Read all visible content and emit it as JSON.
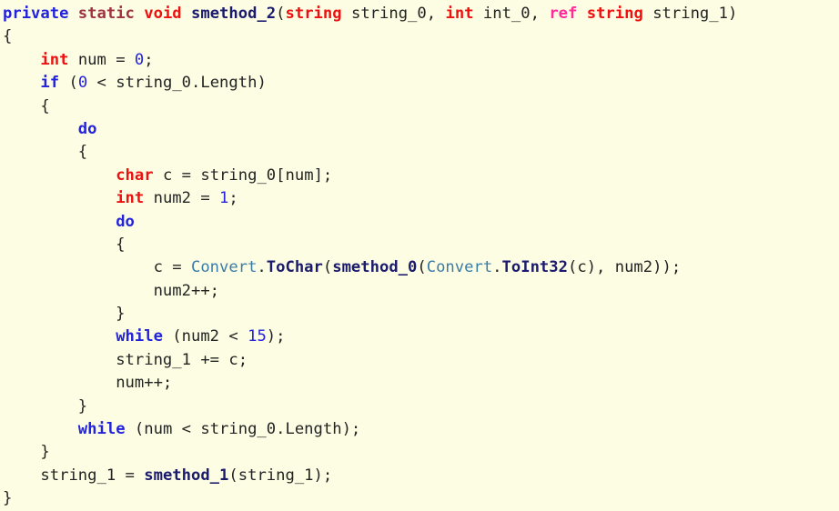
{
  "editor": {
    "name": "decompiled-code-view",
    "language": "csharp",
    "background_color": "#fdfde3",
    "default_text_color": "#232323",
    "line_count": 22,
    "colors": {
      "control_keyword": "#2323dc",
      "modifier_keyword": "#a03242",
      "type_keyword": "#ee1111",
      "ref_keyword": "#ff2b99",
      "number_literal": "#2323dc",
      "method_name": "#1b1b6e",
      "class_name": "#3a7ca8",
      "identifier": "#232323"
    }
  },
  "code": {
    "plain_text": "private static void smethod_2(string string_0, int int_0, ref string string_1)\n{\n    int num = 0;\n    if (0 < string_0.Length)\n    {\n        do\n        {\n            char c = string_0[num];\n            int num2 = 1;\n            do\n            {\n                c = Convert.ToChar(smethod_0(Convert.ToInt32(c), num2));\n                num2++;\n            }\n            while (num2 < 15);\n            string_1 += c;\n            num++;\n        }\n        while (num < string_0.Length);\n    }\n    string_1 = smethod_1(string_1);\n}",
    "lines": [
      {
        "indent": 0,
        "tokens": [
          {
            "t": "private",
            "c": "k-ctrl"
          },
          {
            "t": " ",
            "c": "punct"
          },
          {
            "t": "static",
            "c": "k-mod"
          },
          {
            "t": " ",
            "c": "punct"
          },
          {
            "t": "void",
            "c": "k-type"
          },
          {
            "t": " ",
            "c": "punct"
          },
          {
            "t": "smethod_2",
            "c": "method"
          },
          {
            "t": "(",
            "c": "punct"
          },
          {
            "t": "string",
            "c": "k-type"
          },
          {
            "t": " ",
            "c": "punct"
          },
          {
            "t": "string_0",
            "c": "id"
          },
          {
            "t": ", ",
            "c": "punct"
          },
          {
            "t": "int",
            "c": "k-type"
          },
          {
            "t": " ",
            "c": "punct"
          },
          {
            "t": "int_0",
            "c": "id"
          },
          {
            "t": ", ",
            "c": "punct"
          },
          {
            "t": "ref",
            "c": "k-ref"
          },
          {
            "t": " ",
            "c": "punct"
          },
          {
            "t": "string",
            "c": "k-type"
          },
          {
            "t": " ",
            "c": "punct"
          },
          {
            "t": "string_1",
            "c": "id"
          },
          {
            "t": ")",
            "c": "punct"
          }
        ]
      },
      {
        "indent": 0,
        "tokens": [
          {
            "t": "{",
            "c": "punct"
          }
        ]
      },
      {
        "indent": 0,
        "tokens": [
          {
            "t": "    ",
            "c": "punct"
          },
          {
            "t": "int",
            "c": "k-type"
          },
          {
            "t": " ",
            "c": "punct"
          },
          {
            "t": "num",
            "c": "id"
          },
          {
            "t": " = ",
            "c": "punct"
          },
          {
            "t": "0",
            "c": "num"
          },
          {
            "t": ";",
            "c": "punct"
          }
        ]
      },
      {
        "indent": 0,
        "tokens": [
          {
            "t": "    ",
            "c": "punct"
          },
          {
            "t": "if",
            "c": "k-ctrl"
          },
          {
            "t": " (",
            "c": "punct"
          },
          {
            "t": "0",
            "c": "num"
          },
          {
            "t": " < ",
            "c": "punct"
          },
          {
            "t": "string_0.Length",
            "c": "id"
          },
          {
            "t": ")",
            "c": "punct"
          }
        ]
      },
      {
        "indent": 0,
        "tokens": [
          {
            "t": "    {",
            "c": "punct"
          }
        ]
      },
      {
        "indent": 0,
        "tokens": [
          {
            "t": "        ",
            "c": "punct"
          },
          {
            "t": "do",
            "c": "k-ctrl"
          }
        ]
      },
      {
        "indent": 0,
        "tokens": [
          {
            "t": "        {",
            "c": "punct"
          }
        ]
      },
      {
        "indent": 0,
        "tokens": [
          {
            "t": "            ",
            "c": "punct"
          },
          {
            "t": "char",
            "c": "k-type"
          },
          {
            "t": " ",
            "c": "punct"
          },
          {
            "t": "c",
            "c": "id"
          },
          {
            "t": " = ",
            "c": "punct"
          },
          {
            "t": "string_0",
            "c": "id"
          },
          {
            "t": "[",
            "c": "punct"
          },
          {
            "t": "num",
            "c": "id"
          },
          {
            "t": "];",
            "c": "punct"
          }
        ]
      },
      {
        "indent": 0,
        "tokens": [
          {
            "t": "            ",
            "c": "punct"
          },
          {
            "t": "int",
            "c": "k-type"
          },
          {
            "t": " ",
            "c": "punct"
          },
          {
            "t": "num2",
            "c": "id"
          },
          {
            "t": " = ",
            "c": "punct"
          },
          {
            "t": "1",
            "c": "num"
          },
          {
            "t": ";",
            "c": "punct"
          }
        ]
      },
      {
        "indent": 0,
        "tokens": [
          {
            "t": "            ",
            "c": "punct"
          },
          {
            "t": "do",
            "c": "k-ctrl"
          }
        ]
      },
      {
        "indent": 0,
        "tokens": [
          {
            "t": "            {",
            "c": "punct"
          }
        ]
      },
      {
        "indent": 0,
        "tokens": [
          {
            "t": "                ",
            "c": "punct"
          },
          {
            "t": "c",
            "c": "id"
          },
          {
            "t": " = ",
            "c": "punct"
          },
          {
            "t": "Convert",
            "c": "cls"
          },
          {
            "t": ".",
            "c": "punct"
          },
          {
            "t": "ToChar",
            "c": "method"
          },
          {
            "t": "(",
            "c": "punct"
          },
          {
            "t": "smethod_0",
            "c": "method"
          },
          {
            "t": "(",
            "c": "punct"
          },
          {
            "t": "Convert",
            "c": "cls"
          },
          {
            "t": ".",
            "c": "punct"
          },
          {
            "t": "ToInt32",
            "c": "method"
          },
          {
            "t": "(",
            "c": "punct"
          },
          {
            "t": "c",
            "c": "id"
          },
          {
            "t": "), ",
            "c": "punct"
          },
          {
            "t": "num2",
            "c": "id"
          },
          {
            "t": "));",
            "c": "punct"
          }
        ]
      },
      {
        "indent": 0,
        "tokens": [
          {
            "t": "                ",
            "c": "punct"
          },
          {
            "t": "num2",
            "c": "id"
          },
          {
            "t": "++;",
            "c": "punct"
          }
        ]
      },
      {
        "indent": 0,
        "tokens": [
          {
            "t": "            }",
            "c": "punct"
          }
        ]
      },
      {
        "indent": 0,
        "tokens": [
          {
            "t": "            ",
            "c": "punct"
          },
          {
            "t": "while",
            "c": "k-ctrl"
          },
          {
            "t": " (",
            "c": "punct"
          },
          {
            "t": "num2",
            "c": "id"
          },
          {
            "t": " < ",
            "c": "punct"
          },
          {
            "t": "15",
            "c": "num"
          },
          {
            "t": ");",
            "c": "punct"
          }
        ]
      },
      {
        "indent": 0,
        "tokens": [
          {
            "t": "            ",
            "c": "punct"
          },
          {
            "t": "string_1",
            "c": "id"
          },
          {
            "t": " += ",
            "c": "punct"
          },
          {
            "t": "c",
            "c": "id"
          },
          {
            "t": ";",
            "c": "punct"
          }
        ]
      },
      {
        "indent": 0,
        "tokens": [
          {
            "t": "            ",
            "c": "punct"
          },
          {
            "t": "num",
            "c": "id"
          },
          {
            "t": "++;",
            "c": "punct"
          }
        ]
      },
      {
        "indent": 0,
        "tokens": [
          {
            "t": "        }",
            "c": "punct"
          }
        ]
      },
      {
        "indent": 0,
        "tokens": [
          {
            "t": "        ",
            "c": "punct"
          },
          {
            "t": "while",
            "c": "k-ctrl"
          },
          {
            "t": " (",
            "c": "punct"
          },
          {
            "t": "num",
            "c": "id"
          },
          {
            "t": " < ",
            "c": "punct"
          },
          {
            "t": "string_0.Length",
            "c": "id"
          },
          {
            "t": ");",
            "c": "punct"
          }
        ]
      },
      {
        "indent": 0,
        "tokens": [
          {
            "t": "    }",
            "c": "punct"
          }
        ]
      },
      {
        "indent": 0,
        "tokens": [
          {
            "t": "    ",
            "c": "punct"
          },
          {
            "t": "string_1",
            "c": "id"
          },
          {
            "t": " = ",
            "c": "punct"
          },
          {
            "t": "smethod_1",
            "c": "method"
          },
          {
            "t": "(",
            "c": "punct"
          },
          {
            "t": "string_1",
            "c": "id"
          },
          {
            "t": ");",
            "c": "punct"
          }
        ]
      },
      {
        "indent": 0,
        "tokens": [
          {
            "t": "}",
            "c": "punct"
          }
        ]
      }
    ]
  }
}
